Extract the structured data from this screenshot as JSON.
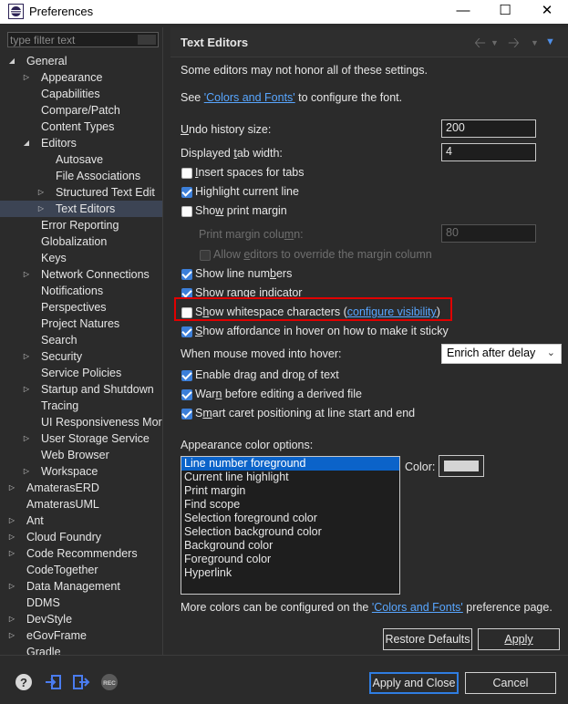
{
  "window": {
    "title": "Preferences",
    "controls": {
      "minimize": "—",
      "maximize": "☐",
      "close": "✕"
    }
  },
  "filter": {
    "placeholder": "type filter text"
  },
  "tree": [
    {
      "label": "General",
      "level": 0,
      "arrow": "open"
    },
    {
      "label": "Appearance",
      "level": 1,
      "arrow": "closed"
    },
    {
      "label": "Capabilities",
      "level": 1,
      "arrow": "none"
    },
    {
      "label": "Compare/Patch",
      "level": 1,
      "arrow": "none"
    },
    {
      "label": "Content Types",
      "level": 1,
      "arrow": "none"
    },
    {
      "label": "Editors",
      "level": 1,
      "arrow": "open"
    },
    {
      "label": "Autosave",
      "level": 2,
      "arrow": "none"
    },
    {
      "label": "File Associations",
      "level": 2,
      "arrow": "none"
    },
    {
      "label": "Structured Text Edit",
      "level": 2,
      "arrow": "closed"
    },
    {
      "label": "Text Editors",
      "level": 2,
      "arrow": "closed",
      "selected": true
    },
    {
      "label": "Error Reporting",
      "level": 1,
      "arrow": "none"
    },
    {
      "label": "Globalization",
      "level": 1,
      "arrow": "none"
    },
    {
      "label": "Keys",
      "level": 1,
      "arrow": "none"
    },
    {
      "label": "Network Connections",
      "level": 1,
      "arrow": "closed"
    },
    {
      "label": "Notifications",
      "level": 1,
      "arrow": "none"
    },
    {
      "label": "Perspectives",
      "level": 1,
      "arrow": "none"
    },
    {
      "label": "Project Natures",
      "level": 1,
      "arrow": "none"
    },
    {
      "label": "Search",
      "level": 1,
      "arrow": "none"
    },
    {
      "label": "Security",
      "level": 1,
      "arrow": "closed"
    },
    {
      "label": "Service Policies",
      "level": 1,
      "arrow": "none"
    },
    {
      "label": "Startup and Shutdown",
      "level": 1,
      "arrow": "closed"
    },
    {
      "label": "Tracing",
      "level": 1,
      "arrow": "none"
    },
    {
      "label": "UI Responsiveness Mor",
      "level": 1,
      "arrow": "none"
    },
    {
      "label": "User Storage Service",
      "level": 1,
      "arrow": "closed"
    },
    {
      "label": "Web Browser",
      "level": 1,
      "arrow": "none"
    },
    {
      "label": "Workspace",
      "level": 1,
      "arrow": "closed"
    },
    {
      "label": "AmaterasERD",
      "level": 0,
      "arrow": "closed"
    },
    {
      "label": "AmaterasUML",
      "level": 0,
      "arrow": "none"
    },
    {
      "label": "Ant",
      "level": 0,
      "arrow": "closed"
    },
    {
      "label": "Cloud Foundry",
      "level": 0,
      "arrow": "closed"
    },
    {
      "label": "Code Recommenders",
      "level": 0,
      "arrow": "closed"
    },
    {
      "label": "CodeTogether",
      "level": 0,
      "arrow": "none"
    },
    {
      "label": "Data Management",
      "level": 0,
      "arrow": "closed"
    },
    {
      "label": "DDMS",
      "level": 0,
      "arrow": "none"
    },
    {
      "label": "DevStyle",
      "level": 0,
      "arrow": "closed"
    },
    {
      "label": "eGovFrame",
      "level": 0,
      "arrow": "closed"
    },
    {
      "label": "Gradle",
      "level": 0,
      "arrow": "none"
    }
  ],
  "page": {
    "title": "Text Editors",
    "note": "Some editors may not honor all of these settings.",
    "see_prefix": "See ",
    "colors_fonts_link": "'Colors and Fonts'",
    "see_suffix": " to configure the font.",
    "undo_label_u": "U",
    "undo_label_rest": "ndo history size:",
    "undo_value": "200",
    "tab_label_pre": "Displayed ",
    "tab_label_u": "t",
    "tab_label_rest": "ab width:",
    "tab_value": "4",
    "checkboxes": {
      "insert_spaces": {
        "pre": "",
        "u": "I",
        "rest": "nsert spaces for tabs",
        "checked": false
      },
      "highlight_line": {
        "pre": "Hi",
        "u": "g",
        "rest": "hlight current line",
        "checked": true
      },
      "print_margin": {
        "pre": "Sho",
        "u": "w",
        "rest": " print margin",
        "checked": false
      },
      "allow_override": {
        "pre": "Allow ",
        "u": "e",
        "rest": "ditors to override the margin column",
        "checked": false
      },
      "line_numbers": {
        "pre": "Show line num",
        "u": "b",
        "rest": "ers",
        "checked": true
      },
      "range_indicator": {
        "pre": "Show ",
        "u": "r",
        "rest": "ange indicator",
        "checked": true
      },
      "whitespace": {
        "pre": "S",
        "u": "h",
        "rest": "ow whitespace characters",
        "checked": false
      },
      "affordance": {
        "pre": "",
        "u": "S",
        "rest": "how affordance in hover on how to make it sticky",
        "checked": true
      },
      "drag_drop": {
        "pre": "Enable drag and dro",
        "u": "p",
        "rest": " of text",
        "checked": true
      },
      "warn_derived": {
        "pre": "War",
        "u": "n",
        "rest": " before editing a derived file",
        "checked": true
      },
      "smart_caret": {
        "pre": "S",
        "u": "m",
        "rest": "art caret positioning at line start and end",
        "checked": true
      }
    },
    "print_margin_column_pre": "Print margin colu",
    "print_margin_column_u": "m",
    "print_margin_column_rest": "n:",
    "print_margin_value": "80",
    "whitespace_open": "(",
    "configure_visibility": "configure visibility",
    "whitespace_close": ")",
    "hover_label": "When mouse moved into hover:",
    "hover_value": "Enrich after delay",
    "appearance_label": "Appearance color options:",
    "color_options": [
      "Line number foreground",
      "Current line highlight",
      "Print margin",
      "Find scope",
      "Selection foreground color",
      "Selection background color",
      "Background color",
      "Foreground color",
      "Hyperlink"
    ],
    "selected_color_option": "Line number foreground",
    "color_label": "Color:",
    "swatch_color": "#d4d4d4",
    "more_prefix": "More colors can be configured on the ",
    "more_link": "'Colors and Fonts'",
    "more_suffix": " preference page.",
    "restore_defaults": "Restore Defaults",
    "apply": "Apply"
  },
  "footer": {
    "apply_close": "Apply and Close",
    "cancel": "Cancel",
    "rec_badge": "REC"
  },
  "colors": {
    "accent": "#2f7de1",
    "highlight_box": "#e00000",
    "link": "#58a6ff"
  }
}
